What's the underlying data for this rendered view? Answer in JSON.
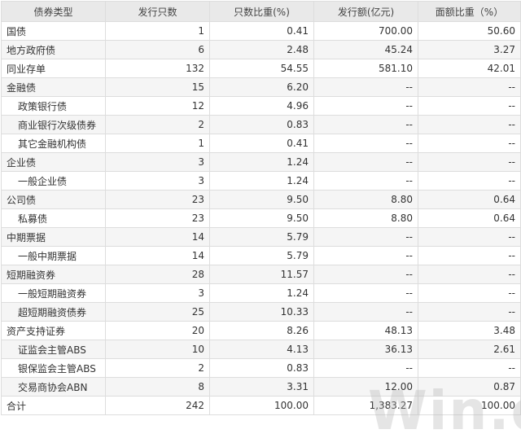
{
  "table": {
    "headers": [
      "债券类型",
      "发行只数",
      "只数比重(%)",
      "发行额(亿元)",
      "面额比重（%）"
    ],
    "rows": [
      {
        "name": "国债",
        "indent": false,
        "count": "1",
        "count_pct": "0.41",
        "amount": "700.00",
        "amount_pct": "50.60"
      },
      {
        "name": "地方政府债",
        "indent": false,
        "count": "6",
        "count_pct": "2.48",
        "amount": "45.24",
        "amount_pct": "3.27"
      },
      {
        "name": "同业存单",
        "indent": false,
        "count": "132",
        "count_pct": "54.55",
        "amount": "581.10",
        "amount_pct": "42.01"
      },
      {
        "name": "金融债",
        "indent": false,
        "count": "15",
        "count_pct": "6.20",
        "amount": "--",
        "amount_pct": "--"
      },
      {
        "name": "政策银行债",
        "indent": true,
        "count": "12",
        "count_pct": "4.96",
        "amount": "--",
        "amount_pct": "--"
      },
      {
        "name": "商业银行次级债券",
        "indent": true,
        "count": "2",
        "count_pct": "0.83",
        "amount": "--",
        "amount_pct": "--"
      },
      {
        "name": "其它金融机构债",
        "indent": true,
        "count": "1",
        "count_pct": "0.41",
        "amount": "--",
        "amount_pct": "--"
      },
      {
        "name": "企业债",
        "indent": false,
        "count": "3",
        "count_pct": "1.24",
        "amount": "--",
        "amount_pct": "--"
      },
      {
        "name": "一般企业债",
        "indent": true,
        "count": "3",
        "count_pct": "1.24",
        "amount": "--",
        "amount_pct": "--"
      },
      {
        "name": "公司债",
        "indent": false,
        "count": "23",
        "count_pct": "9.50",
        "amount": "8.80",
        "amount_pct": "0.64"
      },
      {
        "name": "私募债",
        "indent": true,
        "count": "23",
        "count_pct": "9.50",
        "amount": "8.80",
        "amount_pct": "0.64"
      },
      {
        "name": "中期票据",
        "indent": false,
        "count": "14",
        "count_pct": "5.79",
        "amount": "--",
        "amount_pct": "--"
      },
      {
        "name": "一般中期票据",
        "indent": true,
        "count": "14",
        "count_pct": "5.79",
        "amount": "--",
        "amount_pct": "--"
      },
      {
        "name": "短期融资券",
        "indent": false,
        "count": "28",
        "count_pct": "11.57",
        "amount": "--",
        "amount_pct": "--"
      },
      {
        "name": "一般短期融资券",
        "indent": true,
        "count": "3",
        "count_pct": "1.24",
        "amount": "--",
        "amount_pct": "--"
      },
      {
        "name": "超短期融资债券",
        "indent": true,
        "count": "25",
        "count_pct": "10.33",
        "amount": "--",
        "amount_pct": "--"
      },
      {
        "name": "资产支持证券",
        "indent": false,
        "count": "20",
        "count_pct": "8.26",
        "amount": "48.13",
        "amount_pct": "3.48"
      },
      {
        "name": "证监会主管ABS",
        "indent": true,
        "count": "10",
        "count_pct": "4.13",
        "amount": "36.13",
        "amount_pct": "2.61"
      },
      {
        "name": "银保监会主管ABS",
        "indent": true,
        "count": "2",
        "count_pct": "0.83",
        "amount": "--",
        "amount_pct": "--"
      },
      {
        "name": "交易商协会ABN",
        "indent": true,
        "count": "8",
        "count_pct": "3.31",
        "amount": "12.00",
        "amount_pct": "0.87"
      },
      {
        "name": "合计",
        "indent": false,
        "count": "242",
        "count_pct": "100.00",
        "amount": "1,383.27",
        "amount_pct": "100.00"
      }
    ]
  },
  "watermark": "Win.d",
  "colors": {
    "header_bg": "#e9e9e9",
    "alt_row_bg": "#f5f5f5",
    "border": "#dddddd",
    "text": "#333333"
  }
}
